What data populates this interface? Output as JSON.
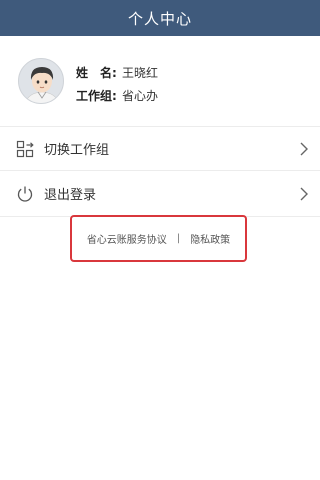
{
  "header": {
    "title": "个人中心"
  },
  "profile": {
    "name_label": "姓　名:",
    "name_value": "王晓红",
    "group_label": "工作组:",
    "group_value": "省心办"
  },
  "menu": {
    "items": [
      {
        "label": "切换工作组",
        "icon": "switch-group-icon"
      },
      {
        "label": "退出登录",
        "icon": "power-icon"
      }
    ]
  },
  "footer_links": {
    "agreement": "省心云账服务协议",
    "separator": "|",
    "privacy": "隐私政策"
  },
  "colors": {
    "header_bg": "#3f5a7c",
    "highlight_border": "#d9373c"
  }
}
